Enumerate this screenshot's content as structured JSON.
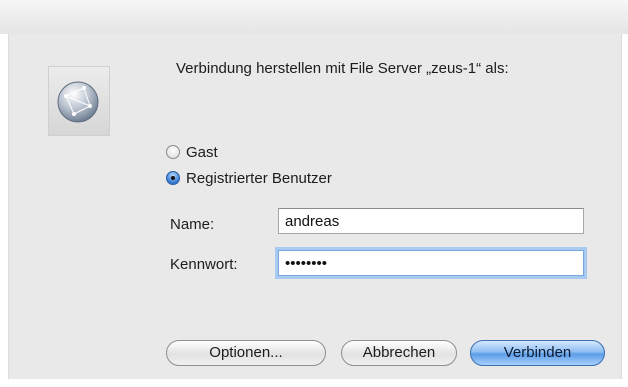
{
  "dialog": {
    "prompt": "Verbindung herstellen mit File Server „zeus-1“ als:",
    "icon": "network-globe-icon"
  },
  "login_mode": {
    "options": [
      {
        "label": "Gast",
        "selected": false
      },
      {
        "label": "Registrierter Benutzer",
        "selected": true
      }
    ]
  },
  "fields": {
    "name_label": "Name:",
    "name_value": "andreas",
    "password_label": "Kennwort:",
    "password_masked": "••••••••"
  },
  "buttons": {
    "options_label": "Optionen...",
    "cancel_label": "Abbrechen",
    "connect_label": "Verbinden"
  },
  "colors": {
    "accent": "#5d9de8",
    "sheet_bg": "#e9e9e9"
  }
}
